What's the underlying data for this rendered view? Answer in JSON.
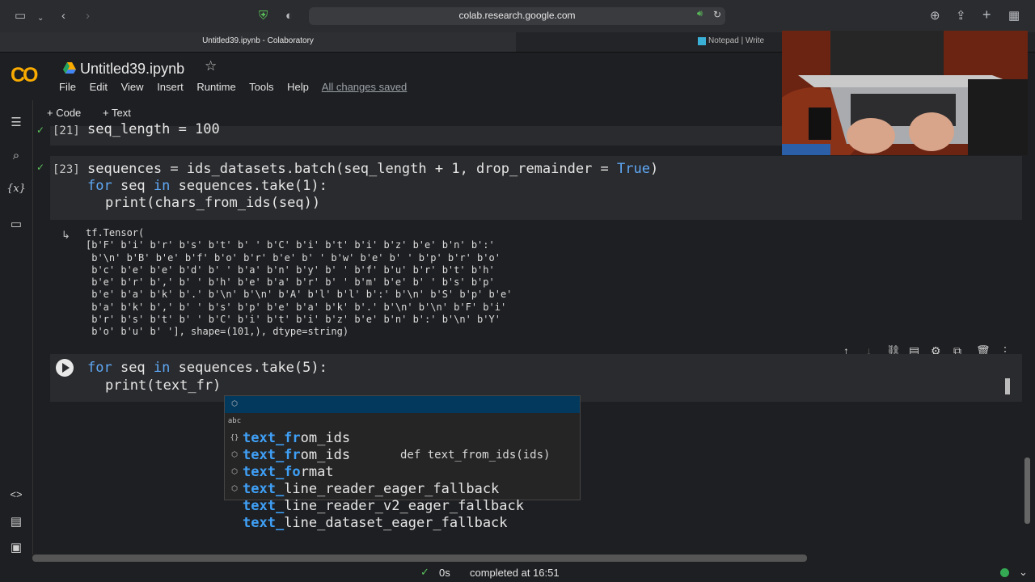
{
  "browser": {
    "url": "colab.research.google.com",
    "tabs": [
      {
        "title": "Untitled39.ipynb - Colaboratory"
      },
      {
        "title": "Notepad | Write"
      }
    ]
  },
  "header": {
    "logo": "CO",
    "notebook_title": "Untitled39.ipynb",
    "menu": [
      "File",
      "Edit",
      "View",
      "Insert",
      "Runtime",
      "Tools",
      "Help"
    ],
    "save_status": "All changes saved"
  },
  "toolbar": {
    "add_code": "+ Code",
    "add_text": "+ Text"
  },
  "cells": {
    "c21": {
      "count": "[21]",
      "code": "seq_length = 100"
    },
    "c23": {
      "count": "[23]",
      "line1": "sequences = ids_datasets.batch(seq_length + 1, drop_remainder = ",
      "line1_kw": "True",
      "line1_end": ")",
      "line2_kw1": "for",
      "line2_a": " seq ",
      "line2_kw2": "in",
      "line2_b": " sequences.take(1):",
      "line3": "print(chars_from_ids(seq))"
    },
    "output": "tf.Tensor(\n[b'F' b'i' b'r' b's' b't' b' ' b'C' b'i' b't' b'i' b'z' b'e' b'n' b':'\n b'\\n' b'B' b'e' b'f' b'o' b'r' b'e' b' ' b'w' b'e' b' ' b'p' b'r' b'o'\n b'c' b'e' b'e' b'd' b' ' b'a' b'n' b'y' b' ' b'f' b'u' b'r' b't' b'h'\n b'e' b'r' b',' b' ' b'h' b'e' b'a' b'r' b' ' b'm' b'e' b' ' b's' b'p'\n b'e' b'a' b'k' b'.' b'\\n' b'\\n' b'A' b'l' b'l' b':' b'\\n' b'S' b'p' b'e'\n b'a' b'k' b',' b' ' b's' b'p' b'e' b'a' b'k' b'.' b'\\n' b'\\n' b'F' b'i'\n b'r' b's' b't' b' ' b'C' b'i' b't' b'i' b'z' b'e' b'n' b':' b'\\n' b'Y'\n b'o' b'u' b' '], shape=(101,), dtype=string)",
    "active": {
      "line1_kw1": "for",
      "line1_a": " seq ",
      "line1_kw2": "in",
      "line1_b": " sequences.take(5):",
      "line2": "print(text_fr)"
    }
  },
  "autocomplete": {
    "items": [
      {
        "icon": "⬡",
        "match": "text_fr",
        "rest": "om_ids",
        "detail": "def text_from_ids(ids)"
      },
      {
        "icon": "abc",
        "match": "text_fr",
        "rest": "om_ids",
        "detail": ""
      },
      {
        "icon": "{}",
        "match": "text_fo",
        "rest": "rmat",
        "detail": ""
      },
      {
        "icon": "⬡",
        "match": "text_",
        "rest": "line_reader_eager_fallback",
        "detail": ""
      },
      {
        "icon": "⬡",
        "match": "text_",
        "rest": "line_reader_v2_eager_fallback",
        "detail": ""
      },
      {
        "icon": "⬡",
        "match": "text_",
        "rest": "line_dataset_eager_fallback",
        "detail": ""
      }
    ]
  },
  "status": {
    "check": "✓",
    "duration": "0s",
    "text": "completed at 16:51"
  },
  "colors": {
    "accent": "#f9ab00",
    "keyword": "#5fa8f5",
    "selection": "#04395e"
  }
}
